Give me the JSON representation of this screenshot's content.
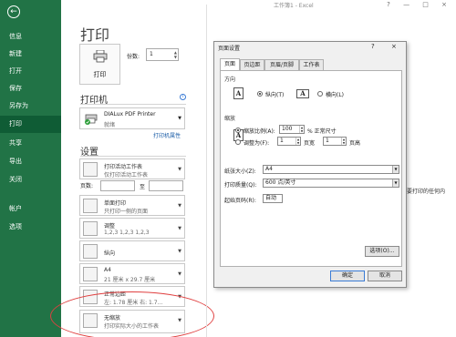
{
  "window": {
    "title": "工作簿1 - Excel",
    "controls": "? — □ ×"
  },
  "sidebar": {
    "back": "←",
    "items": [
      {
        "label": "信息"
      },
      {
        "label": "新建"
      },
      {
        "label": "打开"
      },
      {
        "label": "保存"
      },
      {
        "label": "另存为"
      },
      {
        "label": "打印",
        "active": true
      },
      {
        "label": "共享"
      },
      {
        "label": "导出"
      },
      {
        "label": "关闭"
      },
      {
        "label": "帐户"
      },
      {
        "label": "选项"
      }
    ]
  },
  "print": {
    "title": "打印",
    "button_label": "打印",
    "copies_label": "份数:",
    "copies_value": "1",
    "printer_heading": "打印机",
    "printer_name": "DIALux PDF Printer",
    "printer_status": "就绪",
    "printer_props": "打印机属性",
    "settings_heading": "设置",
    "pages_label": "页数:",
    "to_label": "至",
    "settings": [
      {
        "l1": "打印活动工作表",
        "l2": "仅打印活动工作表"
      },
      {
        "l1": "单面打印",
        "l2": "只打印一侧的页面"
      },
      {
        "l1": "调整",
        "l2": "1,2,3    1,2,3    1,2,3"
      },
      {
        "l1": "纵向",
        "l2": ""
      },
      {
        "l1": "A4",
        "l2": "21 厘米 x 29.7 厘米"
      },
      {
        "l1": "正常边距",
        "l2": "左: 1.78 厘米    右: 1.7..."
      },
      {
        "l1": "无缩放",
        "l2": "打印实际大小的工作表"
      }
    ]
  },
  "preview": {
    "clipped_text": "要打印的任何内"
  },
  "dialog": {
    "title": "页面设置",
    "help": "?",
    "close": "×",
    "tabs": [
      "页面",
      "页边距",
      "页眉/页脚",
      "工作表"
    ],
    "orientation_group": "方向",
    "portrait": "纵向(T)",
    "landscape": "横向(L)",
    "scaling_group": "缩放",
    "scale_label": "缩放比例(A):",
    "scale_value": "100",
    "scale_suffix": "% 正常尺寸",
    "fit_label": "调整为(F):",
    "fit_wide": "1",
    "fit_wide_suffix": "页宽",
    "fit_tall": "1",
    "fit_tall_suffix": "页高",
    "paper_label": "纸张大小(Z):",
    "paper_value": "A4",
    "quality_label": "打印质量(Q):",
    "quality_value": "600 点/英寸",
    "first_page_label": "起始页码(R):",
    "first_page_value": "自动",
    "options_button": "选项(O)...",
    "ok_button": "确定",
    "cancel_button": "取消"
  },
  "colors": {
    "backstage_green": "#217346",
    "annotation_red": "#e04040"
  }
}
